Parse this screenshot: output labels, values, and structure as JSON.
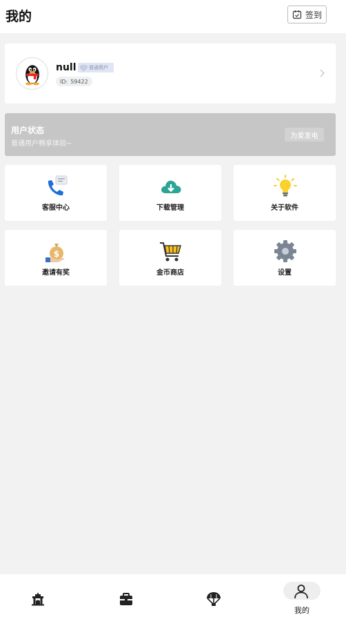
{
  "header": {
    "title": "我的",
    "checkin_label": "签到"
  },
  "profile": {
    "username": "null",
    "badge": "普通用户",
    "id_label": "ID:",
    "id_value": "59422"
  },
  "status_banner": {
    "title": "用户状态",
    "subtitle": "普通用户畅享体验~",
    "button": "为爱发电"
  },
  "tiles": [
    {
      "label": "客服中心",
      "icon": "customer-service-icon"
    },
    {
      "label": "下载管理",
      "icon": "download-cloud-icon"
    },
    {
      "label": "关于软件",
      "icon": "lightbulb-icon"
    },
    {
      "label": "邀请有奖",
      "icon": "money-bag-icon"
    },
    {
      "label": "金币商店",
      "icon": "shopping-cart-icon"
    },
    {
      "label": "设置",
      "icon": "gear-icon"
    }
  ],
  "bottom_nav": {
    "items": [
      "home-icon",
      "store-icon",
      "parachute-icon",
      "user-icon"
    ],
    "active_label": "我的"
  },
  "colors": {
    "accent": "#2a9d8f",
    "banner_bg": "#c6c6c6",
    "page_bg": "#f2f2f2"
  }
}
